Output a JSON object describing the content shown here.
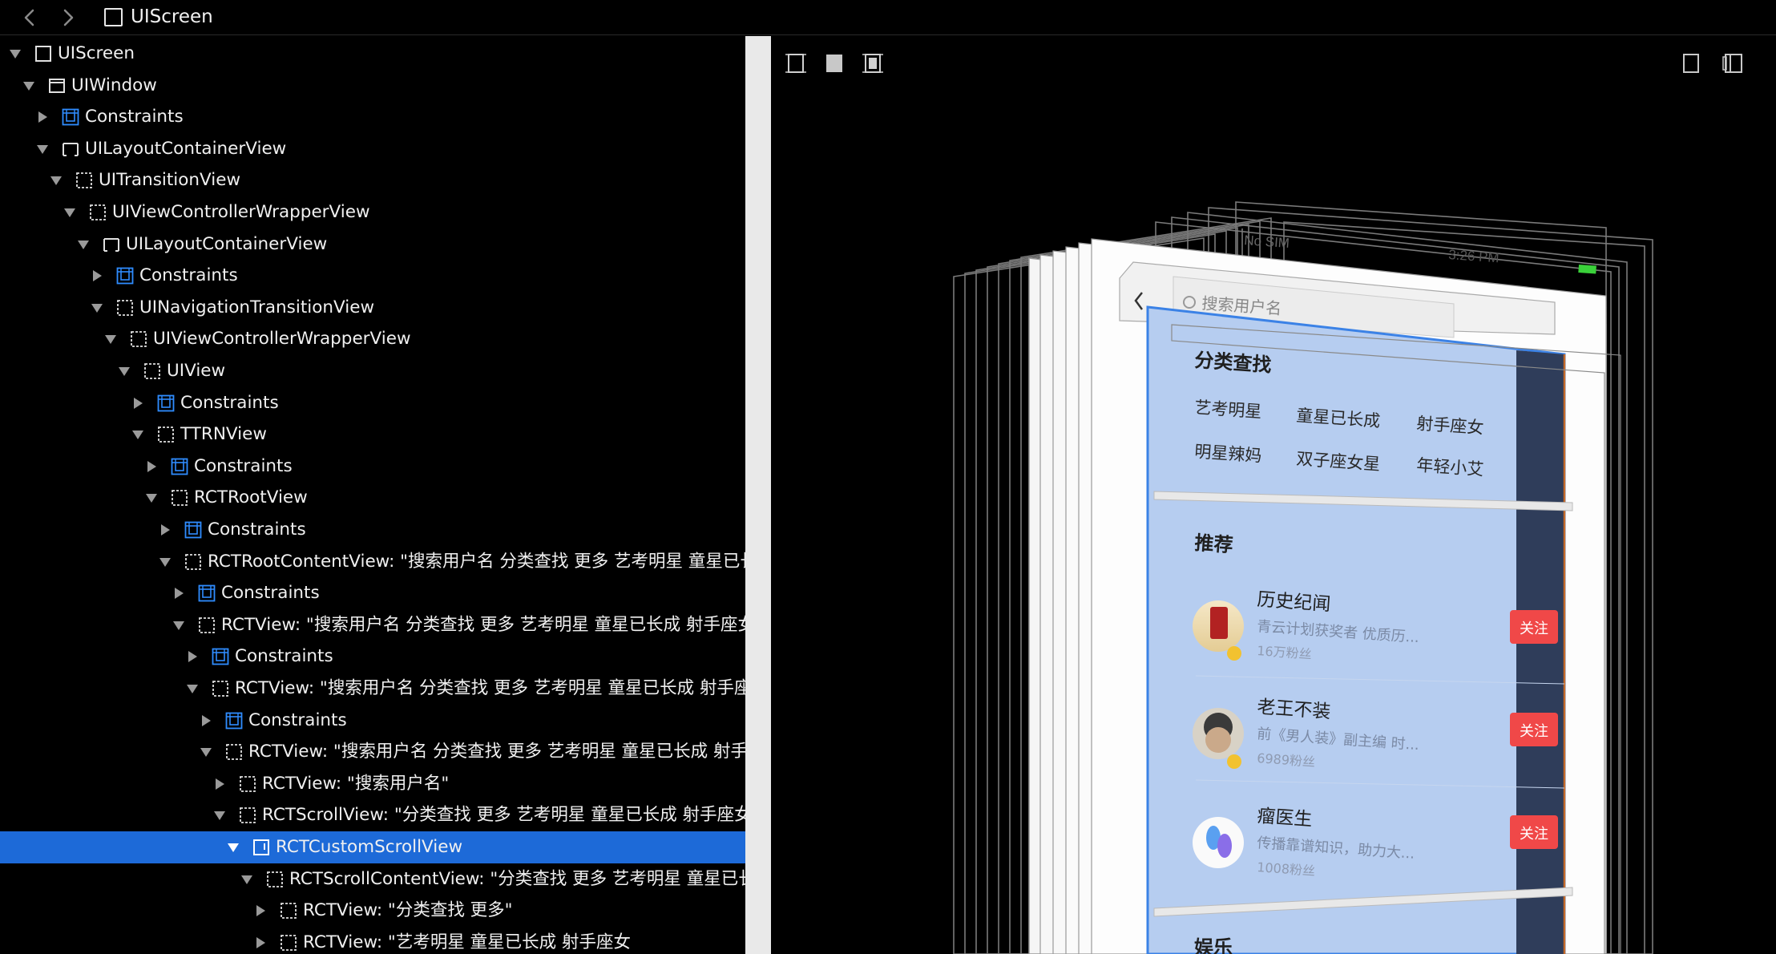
{
  "window": {
    "title": "UIScreen",
    "back_icon": "chevron-left-icon",
    "forward_icon": "chevron-right-icon"
  },
  "tree": [
    {
      "depth": 0,
      "expanded": true,
      "icon": "screen",
      "label": "UIScreen"
    },
    {
      "depth": 1,
      "expanded": true,
      "icon": "window",
      "label": "UIWindow"
    },
    {
      "depth": 2,
      "expanded": false,
      "icon": "constraints",
      "label": "Constraints"
    },
    {
      "depth": 2,
      "expanded": true,
      "icon": "layout",
      "label": "UILayoutContainerView"
    },
    {
      "depth": 3,
      "expanded": true,
      "icon": "view",
      "label": "UITransitionView"
    },
    {
      "depth": 4,
      "expanded": true,
      "icon": "view",
      "label": "UIViewControllerWrapperView"
    },
    {
      "depth": 5,
      "expanded": true,
      "icon": "layout",
      "label": "UILayoutContainerView"
    },
    {
      "depth": 6,
      "expanded": false,
      "icon": "constraints",
      "label": "Constraints"
    },
    {
      "depth": 6,
      "expanded": true,
      "icon": "view",
      "label": "UINavigationTransitionView"
    },
    {
      "depth": 7,
      "expanded": true,
      "icon": "view",
      "label": "UIViewControllerWrapperView"
    },
    {
      "depth": 8,
      "expanded": true,
      "icon": "view",
      "label": "UIView"
    },
    {
      "depth": 9,
      "expanded": false,
      "icon": "constraints",
      "label": "Constraints"
    },
    {
      "depth": 9,
      "expanded": true,
      "icon": "view",
      "label": "TTRNView"
    },
    {
      "depth": 10,
      "expanded": false,
      "icon": "constraints",
      "label": "Constraints"
    },
    {
      "depth": 10,
      "expanded": true,
      "icon": "view",
      "label": "RCTRootView"
    },
    {
      "depth": 11,
      "expanded": false,
      "icon": "constraints",
      "label": "Constraints"
    },
    {
      "depth": 11,
      "expanded": true,
      "icon": "view",
      "label": "RCTRootContentView: \"搜索用户名 分类查找  更多 艺考明星 童星已长成 射手座女"
    },
    {
      "depth": 12,
      "expanded": false,
      "icon": "constraints",
      "label": "Constraints"
    },
    {
      "depth": 12,
      "expanded": true,
      "icon": "view",
      "label": "RCTView: \"搜索用户名 分类查找  更多 艺考明星 童星已长成 射手座女"
    },
    {
      "depth": 13,
      "expanded": false,
      "icon": "constraints",
      "label": "Constraints"
    },
    {
      "depth": 13,
      "expanded": true,
      "icon": "view",
      "label": "RCTView: \"搜索用户名 分类查找  更多 艺考明星 童星已长成 射手座女"
    },
    {
      "depth": 14,
      "expanded": false,
      "icon": "constraints",
      "label": "Constraints"
    },
    {
      "depth": 14,
      "expanded": true,
      "icon": "view",
      "label": "RCTView: \"搜索用户名 分类查找  更多 艺考明星 童星已长成 射手座女"
    },
    {
      "depth": 15,
      "expanded": false,
      "icon": "view",
      "label": "RCTView: \"搜索用户名\""
    },
    {
      "depth": 15,
      "expanded": true,
      "icon": "view",
      "label": "RCTScrollView: \"分类查找  更多 艺考明星 童星已长成 射手座女"
    },
    {
      "depth": 16,
      "expanded": true,
      "icon": "scroll",
      "label": "RCTCustomScrollView",
      "selected": true
    },
    {
      "depth": 17,
      "expanded": true,
      "icon": "view",
      "label": "RCTScrollContentView: \"分类查找  更多 艺考明星 童星已长成"
    },
    {
      "depth": 18,
      "expanded": false,
      "icon": "view",
      "label": "RCTView: \"分类查找  更多\""
    },
    {
      "depth": 18,
      "expanded": false,
      "icon": "view",
      "label": "RCTView: \"艺考明星 童星已长成 射手座女"
    }
  ],
  "toolbar": {
    "left_buttons": [
      "wireframe-view-icon",
      "contents-view-icon",
      "wireframe-contents-view-icon"
    ],
    "right_buttons": [
      "single-pane-icon",
      "split-pane-icon"
    ]
  },
  "preview": {
    "status_left": "No SIM",
    "status_time": "3:26 PM",
    "search_placeholder": "搜索用户名",
    "category_title": "分类查找",
    "categories": [
      "艺考明星",
      "童星已长成",
      "射手座女",
      "明星辣妈",
      "双子座女星",
      "年轻小艾"
    ],
    "recommend_title": "推荐",
    "users": [
      {
        "name": "历史纪闻",
        "desc": "青云计划获奖者 优质历...",
        "fans": "16万粉丝",
        "follow": "关注"
      },
      {
        "name": "老王不装",
        "desc": "前《男人装》副主编 时...",
        "fans": "6989粉丝",
        "follow": "关注"
      },
      {
        "name": "瘤医生",
        "desc": "传播靠谱知识，助力大...",
        "fans": "1008粉丝",
        "follow": "关注"
      }
    ],
    "next_section_title": "娱乐",
    "colors": {
      "selection": "#1d6ad8",
      "follow_button": "#f04848",
      "highlight_panel": "#a9c4ee",
      "battery": "#3ad13a"
    }
  }
}
